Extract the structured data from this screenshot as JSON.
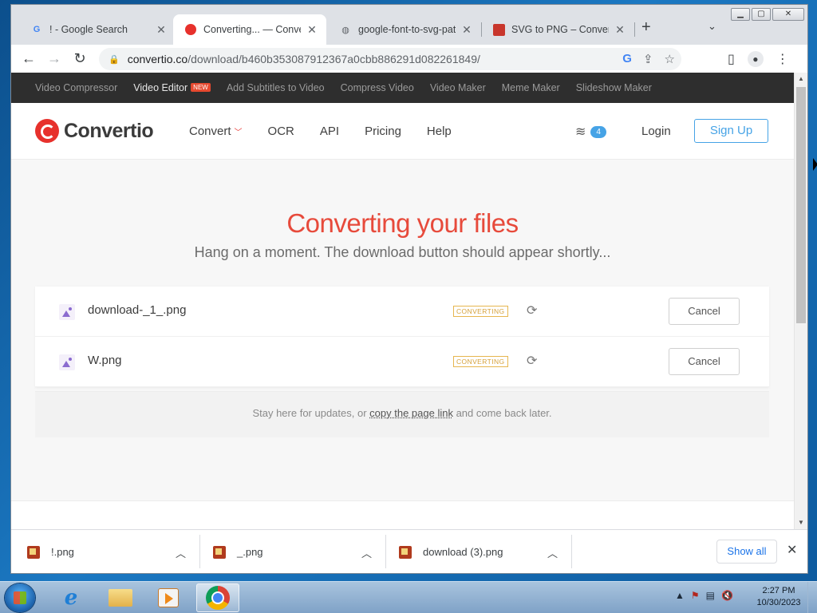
{
  "browser": {
    "tabs": [
      {
        "title": "! - Google Search",
        "favicon": "google-icon",
        "active": false
      },
      {
        "title": "Converting... — Convertio",
        "favicon": "convertio-icon",
        "active": true
      },
      {
        "title": "google-font-to-svg-path",
        "favicon": "globe-icon",
        "active": false
      },
      {
        "title": "SVG to PNG – Convert",
        "favicon": "svg-png-icon",
        "active": false
      }
    ],
    "close_glyph": "✕",
    "new_tab_glyph": "+",
    "tab_menu_glyph": "⌄",
    "address": {
      "host": "convertio.co",
      "path": "/download/b460b353087912367a0cbb886291d082261849/"
    }
  },
  "site": {
    "topbar": [
      {
        "label": "Video Compressor",
        "active": false
      },
      {
        "label": "Video Editor",
        "active": true,
        "badge": "NEW"
      },
      {
        "label": "Add Subtitles to Video",
        "active": false
      },
      {
        "label": "Compress Video",
        "active": false
      },
      {
        "label": "Video Maker",
        "active": false
      },
      {
        "label": "Meme Maker",
        "active": false
      },
      {
        "label": "Slideshow Maker",
        "active": false
      }
    ],
    "logo": "Convertio",
    "nav": [
      "Convert",
      "OCR",
      "API",
      "Pricing",
      "Help"
    ],
    "layers_count": "4",
    "login": "Login",
    "signup": "Sign Up",
    "hero_title": "Converting your files",
    "hero_sub": "Hang on a moment. The download button should appear shortly...",
    "files": [
      {
        "name": "download-_1_.png",
        "status": "CONVERTING",
        "cancel": "Cancel"
      },
      {
        "name": "W.png",
        "status": "CONVERTING",
        "cancel": "Cancel"
      }
    ],
    "notice": {
      "before": "Stay here for updates, or ",
      "link": "copy the page link",
      "after": " and come back later."
    }
  },
  "downloads": {
    "items": [
      "!.png",
      "_.png",
      "download (3).png"
    ],
    "show_all": "Show all"
  },
  "taskbar": {
    "time": "2:27 PM",
    "date": "10/30/2023"
  },
  "colors": {
    "accent_red": "#e74a3b",
    "accent_blue": "#46a3e6",
    "status_amber": "#d6a23c"
  }
}
